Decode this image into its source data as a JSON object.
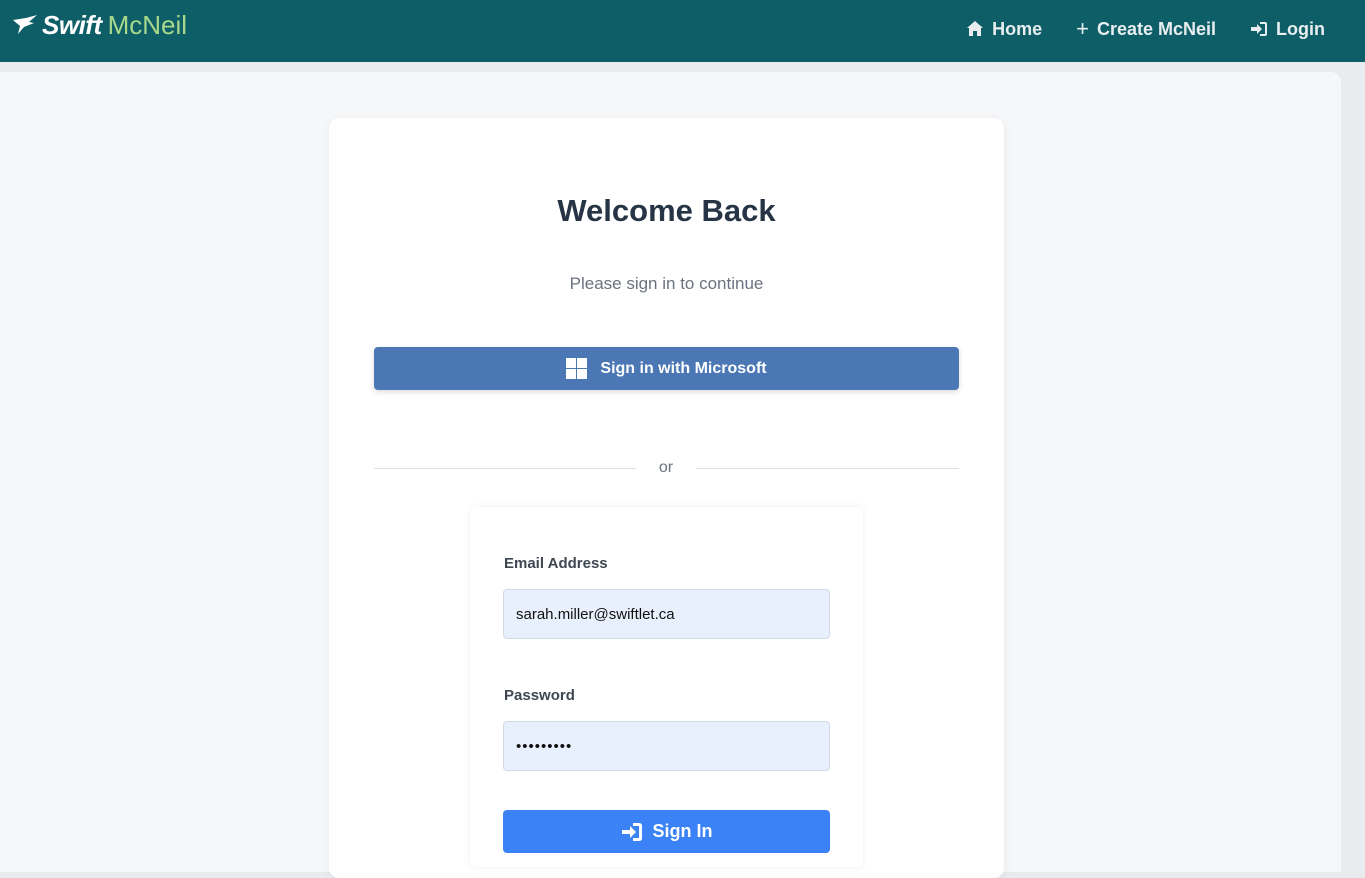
{
  "brand": {
    "icon": "swift-bird-icon",
    "swift": "Swift",
    "mcneil": "McNeil"
  },
  "nav": {
    "items": [
      {
        "label": "Home",
        "icon": "home-icon"
      },
      {
        "label": "Create McNeil",
        "icon": "plus-icon"
      },
      {
        "label": "Login",
        "icon": "login-icon"
      }
    ]
  },
  "login": {
    "title": "Welcome Back",
    "subtitle": "Please sign in to continue",
    "microsoft_button": "Sign in with Microsoft",
    "microsoft_icon": "windows-logo-icon",
    "divider_text": "or",
    "email_label": "Email Address",
    "email_value": "sarah.miller@swiftlet.ca",
    "password_label": "Password",
    "password_value": "•••••••••",
    "submit_label": "Sign In",
    "submit_icon": "sign-in-icon"
  },
  "colors": {
    "navbar": "#0e5e68",
    "brand_accent": "#a8d98a",
    "microsoft_button": "#4b78b5",
    "primary_button": "#3b82f6",
    "input_background": "#e8f0fd"
  }
}
